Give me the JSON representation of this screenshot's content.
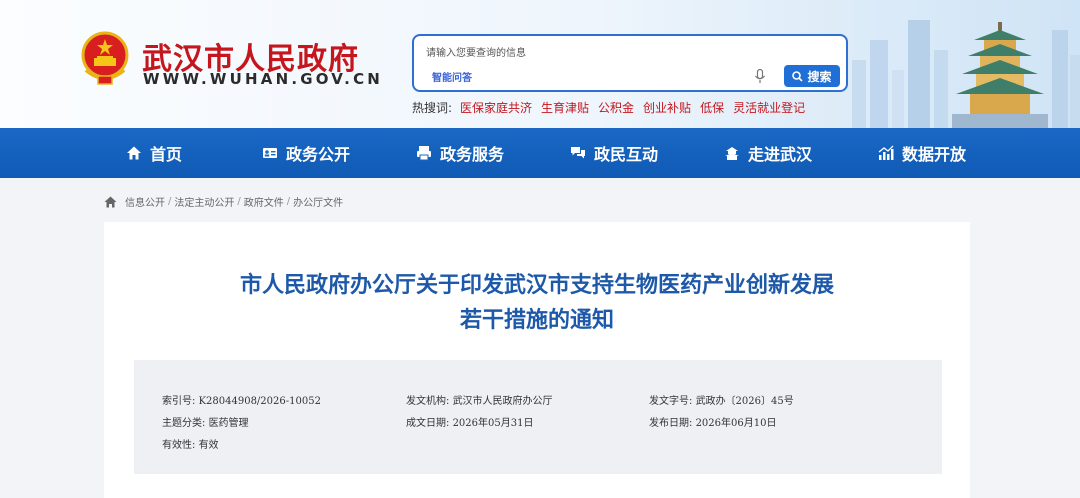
{
  "header": {
    "site_title": "武汉市人民政府",
    "site_domain": "WWW.WUHAN.GOV.CN",
    "brand_color": "#c4161c"
  },
  "search": {
    "placeholder": "请输入您要查询的信息",
    "smart_qa": "智能问答",
    "button_label": "搜索",
    "hot_label": "热搜词:",
    "hot_terms": [
      "医保家庭共济",
      "生育津贴",
      "公积金",
      "创业补贴",
      "低保",
      "灵活就业登记"
    ]
  },
  "nav": {
    "items": [
      {
        "label": "首页",
        "icon": "home-icon"
      },
      {
        "label": "政务公开",
        "icon": "id-card-icon"
      },
      {
        "label": "政务服务",
        "icon": "printer-icon"
      },
      {
        "label": "政民互动",
        "icon": "chat-icon"
      },
      {
        "label": "走进武汉",
        "icon": "landmark-icon"
      },
      {
        "label": "数据开放",
        "icon": "chart-icon"
      }
    ],
    "color": "#1a69c6"
  },
  "breadcrumb": {
    "items": [
      "信息公开",
      "法定主动公开",
      "政府文件",
      "办公厅文件"
    ],
    "separator": "/"
  },
  "document": {
    "title_line1": "市人民政府办公厅关于印发武汉市支持生物医药产业创新发展",
    "title_line2": "若干措施的通知",
    "meta": {
      "index_label": "索引号:",
      "index_value": "K28044908/2026-10052",
      "issuer_label": "发文机构:",
      "issuer_value": "武汉市人民政府办公厅",
      "doc_no_label": "发文字号:",
      "doc_no_value": "武政办〔2026〕45号",
      "topic_label": "主题分类:",
      "topic_value": "医药管理",
      "written_label": "成文日期:",
      "written_value": "2026年05月31日",
      "publish_label": "发布日期:",
      "publish_value": "2026年06月10日",
      "validity_label": "有效性:",
      "validity_value": "有效"
    }
  }
}
